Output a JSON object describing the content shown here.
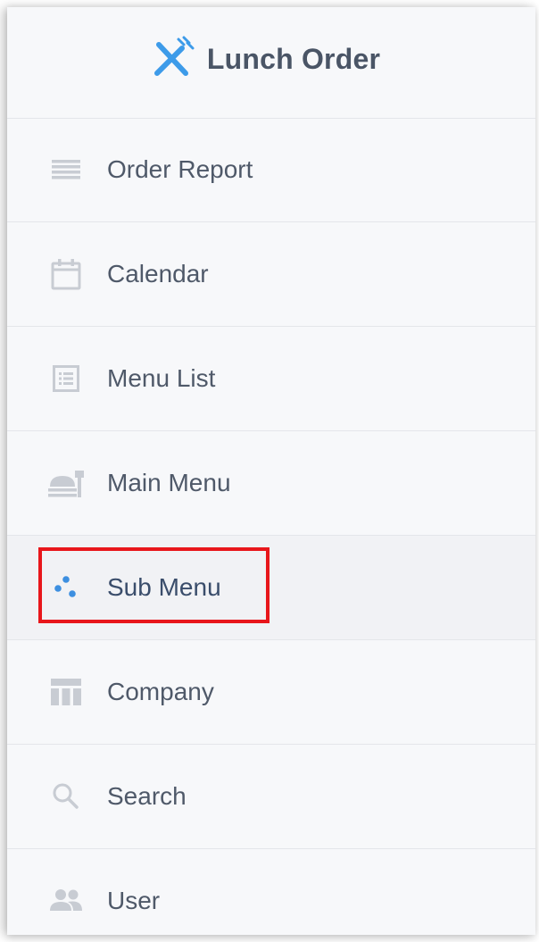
{
  "app": {
    "title": "Lunch Order",
    "icon": "fork-knife-icon",
    "accent_color": "#3d9be9"
  },
  "sidebar": {
    "items": [
      {
        "label": "Order Report",
        "icon": "list-lines-icon"
      },
      {
        "label": "Calendar",
        "icon": "calendar-icon"
      },
      {
        "label": "Menu List",
        "icon": "list-box-icon"
      },
      {
        "label": "Main Menu",
        "icon": "food-tray-icon"
      },
      {
        "label": "Sub Menu",
        "icon": "dots-icon",
        "active": true
      },
      {
        "label": "Company",
        "icon": "table-icon"
      },
      {
        "label": "Search",
        "icon": "search-icon"
      },
      {
        "label": "User",
        "icon": "users-icon"
      }
    ],
    "highlight_color": "#e8161b"
  }
}
